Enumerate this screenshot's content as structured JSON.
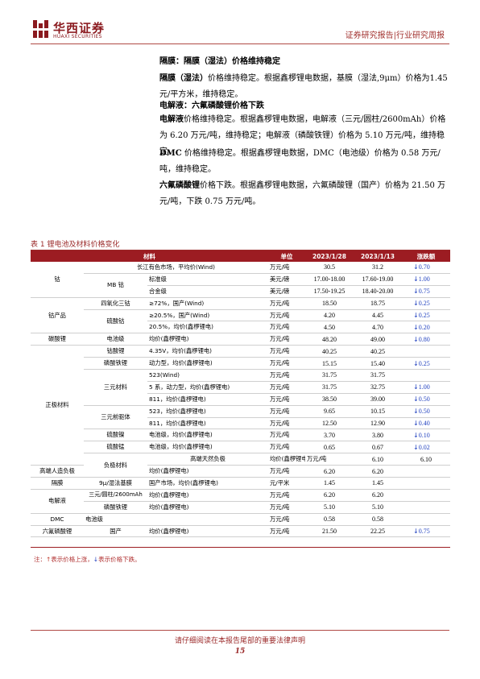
{
  "header": {
    "logo_cn": "华西证券",
    "logo_en": "HUAXI SECURITIES",
    "report_type": "证券研究报告|行业研究周报"
  },
  "body": {
    "h1": "隔膜：隔膜（湿法）价格维持稳定",
    "p1_bold": "隔膜（湿法）",
    "p1_text": "价格维持稳定。根据鑫椤锂电数据，基膜（湿法,9μm）价格为1.45 元/平方米，维持稳定。",
    "h2": "电解液：六氟磷酸锂价格下跌",
    "p2_bold": "电解液",
    "p2_text": "价格维持稳定。根据鑫椤锂电数据，电解液（三元/圆柱/2600mAh）价格为 6.20 万元/吨，维持稳定；电解液（磷酸铁锂）价格为 5.10 万元/吨，维持稳定。",
    "p3_bold": "DMC",
    "p3_text": " 价格维持稳定。根据鑫椤锂电数据，DMC（电池级）价格为 0.58 万元/吨，维持稳定。",
    "p4_bold": "六氟磷酸锂",
    "p4_text": "价格下跌。根据鑫椤锂电数据，六氟磷酸锂（国产）价格为 21.50 万元/吨，下跌 0.75 万元/吨。"
  },
  "table": {
    "title": "表 1 锂电池及材料价格变化",
    "headers": [
      "材料",
      "单位",
      "2023/1/28",
      "2023/1/13",
      "涨跌额"
    ],
    "rows": [
      {
        "c1": "",
        "c2": "长江有色市场，平均价(Wind)",
        "c3": "",
        "unit": "万元/吨",
        "v1": "30.5",
        "v2": "31.2",
        "chg": "0.70",
        "dir": "down"
      },
      {
        "c1": "钴",
        "c2": "MB 钴",
        "c3": "标准级",
        "unit": "美元/磅",
        "v1": "17.00-18.00",
        "v2": "17.60-19.00",
        "chg": "1.00",
        "dir": "down"
      },
      {
        "c1": "",
        "c2": "",
        "c3": "合金级",
        "unit": "美元/磅",
        "v1": "17.50-19.25",
        "v2": "18.40-20.00",
        "chg": "0.75",
        "dir": "down"
      },
      {
        "c1": "钴产品",
        "c2": "四氧化三钴",
        "c3": "≥72%，国产(Wind)",
        "unit": "万元/吨",
        "v1": "18.50",
        "v2": "18.75",
        "chg": "0.25",
        "dir": "down"
      },
      {
        "c1": "",
        "c2": "硫酸钴",
        "c3": "≥20.5%，国产(Wind)",
        "unit": "万元/吨",
        "v1": "4.20",
        "v2": "4.45",
        "chg": "0.25",
        "dir": "down"
      },
      {
        "c1": "",
        "c2": "",
        "c3": "20.5%，均价(鑫椤锂电)",
        "unit": "万元/吨",
        "v1": "4.50",
        "v2": "4.70",
        "chg": "0.20",
        "dir": "down"
      },
      {
        "c1": "碳酸锂",
        "c2": "电池级",
        "c3": "均价(鑫椤锂电)",
        "unit": "万元/吨",
        "v1": "48.20",
        "v2": "49.00",
        "chg": "0.80",
        "dir": "down"
      },
      {
        "c1": "正极材料",
        "c2": "钴酸锂",
        "c3": "4.35V，均价(鑫椤锂电)",
        "unit": "万元/吨",
        "v1": "40.25",
        "v2": "40.25",
        "chg": "",
        "dir": ""
      },
      {
        "c1": "",
        "c2": "磷酸铁锂",
        "c3": "动力型，均价(鑫椤锂电)",
        "unit": "万元/吨",
        "v1": "15.15",
        "v2": "15.40",
        "chg": "0.25",
        "dir": "down"
      },
      {
        "c1": "",
        "c2": "三元材料",
        "c3": "523(Wind)",
        "unit": "万元/吨",
        "v1": "31.75",
        "v2": "31.75",
        "chg": "",
        "dir": ""
      },
      {
        "c1": "",
        "c2": "",
        "c3": "5 系，动力型，均价(鑫椤锂电)",
        "unit": "万元/吨",
        "v1": "31.75",
        "v2": "32.75",
        "chg": "1.00",
        "dir": "down"
      },
      {
        "c1": "",
        "c2": "",
        "c3": "811，均价(鑫椤锂电)",
        "unit": "万元/吨",
        "v1": "38.50",
        "v2": "39.00",
        "chg": "0.50",
        "dir": "down"
      },
      {
        "c1": "",
        "c2": "三元前驱体",
        "c3": "523，均价(鑫椤锂电)",
        "unit": "万元/吨",
        "v1": "9.65",
        "v2": "10.15",
        "chg": "0.50",
        "dir": "down"
      },
      {
        "c1": "",
        "c2": "",
        "c3": "811，均价(鑫椤锂电)",
        "unit": "万元/吨",
        "v1": "12.50",
        "v2": "12.90",
        "chg": "0.40",
        "dir": "down"
      },
      {
        "c1": "",
        "c2": "硫酸镍",
        "c3": "电池级，均价(鑫椤锂电)",
        "unit": "万元/吨",
        "v1": "3.70",
        "v2": "3.80",
        "chg": "0.10",
        "dir": "down"
      },
      {
        "c1": "",
        "c2": "硫酸锰",
        "c3": "电池级，均价(鑫椤锂电)",
        "unit": "万元/吨",
        "v1": "0.65",
        "v2": "0.67",
        "chg": "0.02",
        "dir": "down"
      },
      {
        "c1": "负极材料",
        "c2": "高端天然负极",
        "c3": "均价(鑫椤锂电)",
        "unit": "万元/吨",
        "v1": "6.10",
        "v2": "6.10",
        "chg": "",
        "dir": ""
      },
      {
        "c1": "",
        "c2": "高端人造负极",
        "c3": "均价(鑫椤锂电)",
        "unit": "万元/吨",
        "v1": "6.20",
        "v2": "6.20",
        "chg": "",
        "dir": ""
      },
      {
        "c1": "隔膜",
        "c2": "9μ/湿法基膜",
        "c3": "国产市场，均价(鑫椤锂电)",
        "unit": "元/平米",
        "v1": "1.45",
        "v2": "1.45",
        "chg": "",
        "dir": ""
      },
      {
        "c1": "电解液",
        "c2": "三元/圆柱/2600mAh",
        "c3": "均价(鑫椤锂电)",
        "unit": "万元/吨",
        "v1": "6.20",
        "v2": "6.20",
        "chg": "",
        "dir": ""
      },
      {
        "c1": "",
        "c2": "磷酸铁锂",
        "c3": "均价(鑫椤锂电)",
        "unit": "万元/吨",
        "v1": "5.10",
        "v2": "5.10",
        "chg": "",
        "dir": ""
      },
      {
        "c1": "DMC",
        "c2": "电池级",
        "c3": "",
        "unit": "万元/吨",
        "v1": "0.58",
        "v2": "0.58",
        "chg": "",
        "dir": ""
      },
      {
        "c1": "六氟磷酸锂",
        "c2": "国产",
        "c3": "均价(鑫椤锂电)",
        "unit": "万元/吨",
        "v1": "21.50",
        "v2": "22.25",
        "chg": "0.75",
        "dir": "down"
      }
    ],
    "note_prefix": "注：",
    "note_up": "表示价格上涨，",
    "note_down": "表示价格下跌。"
  },
  "footer": {
    "disclaimer": "请仔细阅读在本报告尾部的重要法律声明",
    "page": "15"
  },
  "colors": {
    "brand": "#9c1c22",
    "down": "#1f3fbf",
    "up": "#c0392b"
  }
}
